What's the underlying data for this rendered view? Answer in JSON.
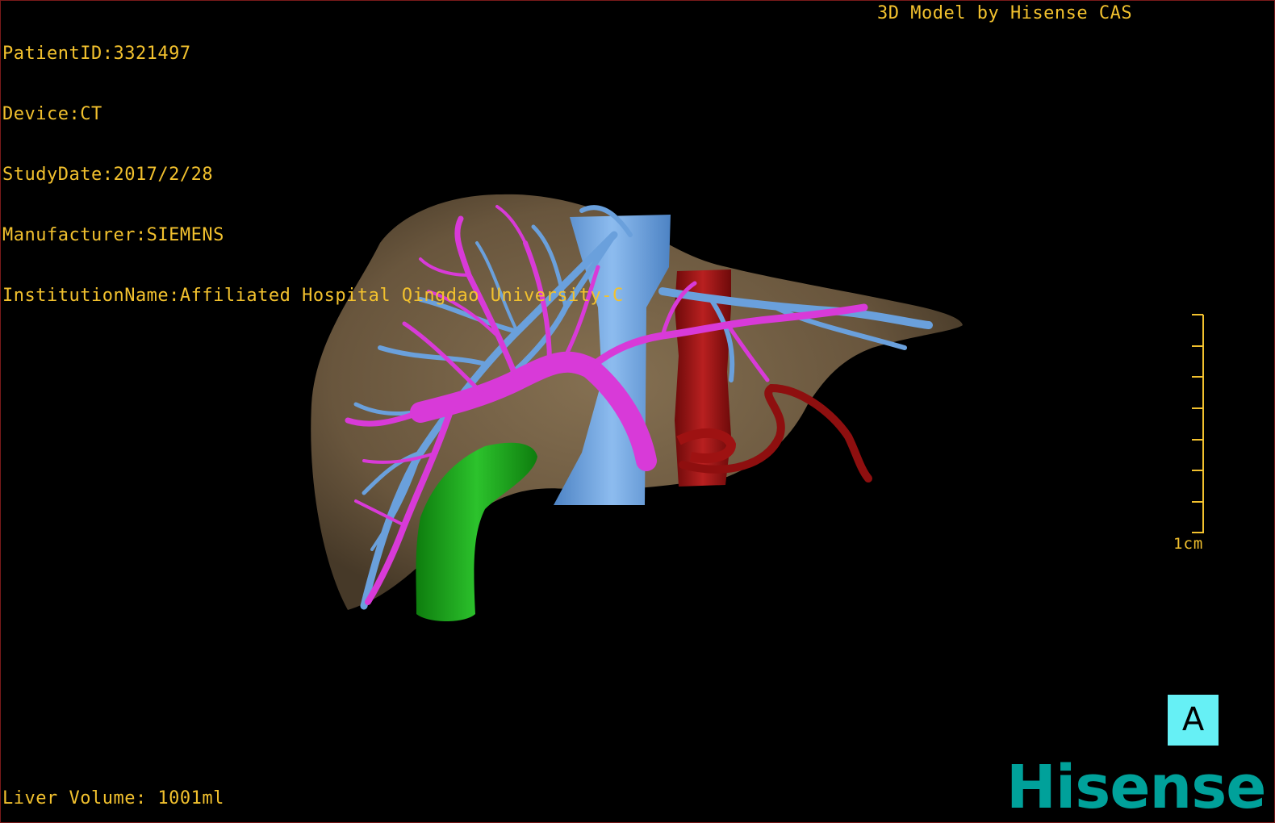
{
  "overlay": {
    "patient_id": "PatientID:3321497",
    "device": "Device:CT",
    "study_date": "StudyDate:2017/2/28",
    "manufacturer": "Manufacturer:SIEMENS",
    "institution": "InstitutionName:Affiliated Hospital Qingdao University-C",
    "model_credit": "3D Model by Hisense CAS",
    "liver_volume": "Liver Volume: 1001ml"
  },
  "scale": {
    "label": "1cm"
  },
  "orientation": {
    "label": "A"
  },
  "brand": {
    "name": "Hisense",
    "color": "#00a19a"
  },
  "colors": {
    "text": "#f2c12e",
    "liver": "#7a6548",
    "hepatic_vein": "#6aa0dc",
    "portal_vein": "#d83ad8",
    "artery_aorta": "#9e1212",
    "gallbladder_duct": "#1fa51f",
    "orientation_box": "#66f0f5"
  }
}
